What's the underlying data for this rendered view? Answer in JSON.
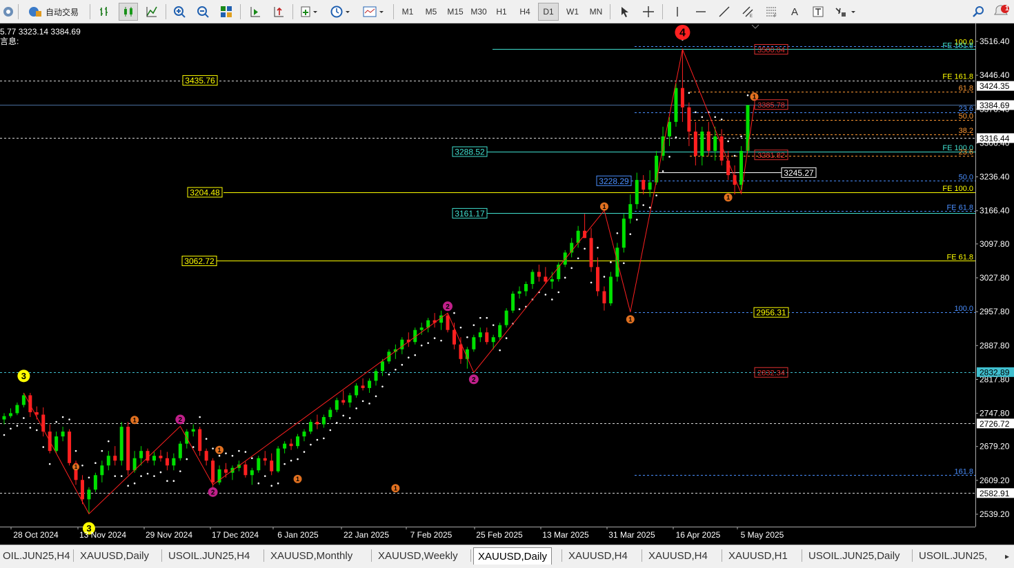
{
  "toolbar": {
    "auto_trade_label": "自动交易",
    "timeframes": [
      "M1",
      "M5",
      "M15",
      "M30",
      "H1",
      "H4",
      "D1",
      "W1",
      "MN"
    ],
    "active_timeframe": "D1",
    "text_tool": "A",
    "alert_count": "1"
  },
  "info": {
    "ohlc_fragment": "5.77 3323.14 3384.69",
    "line2": "言息:"
  },
  "price_axis": {
    "ticks": [
      "3516.40",
      "3446.40",
      "3376.40",
      "3306.40",
      "3236.40",
      "3166.40",
      "3097.80",
      "3027.80",
      "2957.80",
      "2887.80",
      "2817.80",
      "2747.80",
      "2679.20",
      "2609.20",
      "2539.20"
    ],
    "tags": [
      {
        "text": "3424.35",
        "style": "white"
      },
      {
        "text": "3384.69",
        "style": "white"
      },
      {
        "text": "3316.44",
        "style": "white"
      },
      {
        "text": "2832.89",
        "style": "cyan"
      },
      {
        "text": "2726.72",
        "style": "white"
      },
      {
        "text": "2582.91",
        "style": "white"
      }
    ]
  },
  "time_axis": [
    "28 Oct 2024",
    "13 Nov 2024",
    "29 Nov 2024",
    "17 Dec 2024",
    "6 Jan 2025",
    "22 Jan 2025",
    "7 Feb 2025",
    "25 Feb 2025",
    "13 Mar 2025",
    "31 Mar 2025",
    "16 Apr 2025",
    "5 May 2025"
  ],
  "price_labels": [
    {
      "text": "3435.76",
      "color": "#ffff00"
    },
    {
      "text": "3288.52",
      "color": "#40e0d0"
    },
    {
      "text": "3228.29",
      "color": "#4a8fff"
    },
    {
      "text": "3245.27",
      "color": "#ffffff"
    },
    {
      "text": "3204.48",
      "color": "#ffff00"
    },
    {
      "text": "3161.17",
      "color": "#40e0d0"
    },
    {
      "text": "3062.72",
      "color": "#ffff00"
    },
    {
      "text": "2956.31",
      "color": "#ffff00"
    },
    {
      "text": "3500.04",
      "color": "#e03030"
    },
    {
      "text": "3385.78",
      "color": "#e03030"
    },
    {
      "text": "3281.82",
      "color": "#e03030"
    },
    {
      "text": "2832.34",
      "color": "#e03030"
    }
  ],
  "fib_labels": [
    {
      "text": "100.0",
      "color": "#ffff00"
    },
    {
      "text": "FE 161.8",
      "color": "#40e0d0"
    },
    {
      "text": "FE 161.8",
      "color": "#ffff00"
    },
    {
      "text": "61.8",
      "color": "#ff9933"
    },
    {
      "text": "23.6",
      "color": "#4a8fff"
    },
    {
      "text": "50.0",
      "color": "#ff9933"
    },
    {
      "text": "38.2",
      "color": "#ff9933"
    },
    {
      "text": "FE 100.0",
      "color": "#40e0d0"
    },
    {
      "text": "23.6",
      "color": "#ff9933"
    },
    {
      "text": "50.0",
      "color": "#4a8fff"
    },
    {
      "text": "FE 100.0",
      "color": "#ffff00"
    },
    {
      "text": "FE 61.8",
      "color": "#4a8fff"
    },
    {
      "text": "FE 61.8",
      "color": "#ffff00"
    },
    {
      "text": "100.0",
      "color": "#4a8fff"
    },
    {
      "text": "161.8",
      "color": "#4a8fff"
    }
  ],
  "wave_labels": [
    {
      "text": "3",
      "color": "#ffff00"
    },
    {
      "text": "4",
      "color": "#ff2020"
    },
    {
      "text": "1",
      "color": "#e07020"
    },
    {
      "text": "2",
      "color": "#c0208a"
    }
  ],
  "tabs": [
    "OIL.JUN25,H4",
    "XAUUSD,Daily",
    "USOIL.JUN25,H4",
    "XAUUSD,Monthly",
    "XAUUSD,Weekly",
    "XAUUSD,Daily",
    "XAUUSD,H4",
    "XAUUSD,H4",
    "XAUUSD,H1",
    "USOIL.JUN25,Daily",
    "USOIL.JUN25,"
  ],
  "active_tab": 5,
  "chart_data": {
    "type": "candlestick",
    "symbol_timeframe": "XAUUSD,Daily",
    "ylim": [
      2510,
      3550
    ],
    "bull_color": "#00e000",
    "bear_color": "#ff2020",
    "candles": [
      [
        2735,
        2748,
        2725,
        2742
      ],
      [
        2742,
        2758,
        2738,
        2748
      ],
      [
        2748,
        2770,
        2744,
        2765
      ],
      [
        2765,
        2790,
        2760,
        2785
      ],
      [
        2785,
        2790,
        2740,
        2750
      ],
      [
        2750,
        2762,
        2735,
        2745
      ],
      [
        2745,
        2760,
        2700,
        2710
      ],
      [
        2710,
        2725,
        2665,
        2670
      ],
      [
        2670,
        2710,
        2665,
        2700
      ],
      [
        2700,
        2720,
        2690,
        2710
      ],
      [
        2710,
        2715,
        2640,
        2645
      ],
      [
        2645,
        2650,
        2600,
        2610
      ],
      [
        2610,
        2620,
        2560,
        2570
      ],
      [
        2570,
        2595,
        2540,
        2590
      ],
      [
        2590,
        2625,
        2585,
        2620
      ],
      [
        2620,
        2650,
        2605,
        2640
      ],
      [
        2640,
        2670,
        2630,
        2660
      ],
      [
        2660,
        2680,
        2640,
        2650
      ],
      [
        2650,
        2730,
        2640,
        2720
      ],
      [
        2720,
        2730,
        2620,
        2630
      ],
      [
        2630,
        2670,
        2625,
        2655
      ],
      [
        2655,
        2680,
        2640,
        2670
      ],
      [
        2670,
        2675,
        2645,
        2650
      ],
      [
        2650,
        2668,
        2640,
        2660
      ],
      [
        2660,
        2672,
        2648,
        2655
      ],
      [
        2655,
        2668,
        2630,
        2640
      ],
      [
        2640,
        2665,
        2630,
        2655
      ],
      [
        2655,
        2690,
        2650,
        2685
      ],
      [
        2685,
        2715,
        2675,
        2710
      ],
      [
        2710,
        2725,
        2700,
        2715
      ],
      [
        2715,
        2720,
        2660,
        2670
      ],
      [
        2670,
        2675,
        2640,
        2650
      ],
      [
        2650,
        2655,
        2595,
        2605
      ],
      [
        2605,
        2640,
        2600,
        2632
      ],
      [
        2632,
        2645,
        2615,
        2625
      ],
      [
        2625,
        2640,
        2610,
        2635
      ],
      [
        2635,
        2650,
        2628,
        2642
      ],
      [
        2642,
        2648,
        2615,
        2620
      ],
      [
        2620,
        2635,
        2600,
        2630
      ],
      [
        2630,
        2660,
        2625,
        2655
      ],
      [
        2655,
        2670,
        2640,
        2650
      ],
      [
        2650,
        2665,
        2620,
        2628
      ],
      [
        2628,
        2680,
        2625,
        2675
      ],
      [
        2675,
        2690,
        2665,
        2685
      ],
      [
        2685,
        2695,
        2672,
        2680
      ],
      [
        2680,
        2705,
        2675,
        2700
      ],
      [
        2700,
        2715,
        2690,
        2710
      ],
      [
        2710,
        2735,
        2705,
        2730
      ],
      [
        2730,
        2745,
        2715,
        2725
      ],
      [
        2725,
        2745,
        2718,
        2740
      ],
      [
        2740,
        2760,
        2735,
        2755
      ],
      [
        2755,
        2780,
        2750,
        2775
      ],
      [
        2775,
        2795,
        2765,
        2770
      ],
      [
        2770,
        2790,
        2760,
        2785
      ],
      [
        2785,
        2810,
        2780,
        2805
      ],
      [
        2805,
        2820,
        2795,
        2800
      ],
      [
        2800,
        2820,
        2790,
        2815
      ],
      [
        2815,
        2840,
        2805,
        2835
      ],
      [
        2835,
        2860,
        2825,
        2855
      ],
      [
        2855,
        2880,
        2850,
        2875
      ],
      [
        2875,
        2890,
        2860,
        2880
      ],
      [
        2880,
        2905,
        2870,
        2900
      ],
      [
        2900,
        2915,
        2885,
        2895
      ],
      [
        2895,
        2925,
        2890,
        2920
      ],
      [
        2920,
        2935,
        2910,
        2925
      ],
      [
        2925,
        2945,
        2915,
        2940
      ],
      [
        2940,
        2955,
        2925,
        2935
      ],
      [
        2935,
        2960,
        2920,
        2950
      ],
      [
        2950,
        2955,
        2915,
        2920
      ],
      [
        2920,
        2935,
        2880,
        2890
      ],
      [
        2890,
        2905,
        2850,
        2860
      ],
      [
        2860,
        2885,
        2840,
        2880
      ],
      [
        2880,
        2910,
        2875,
        2905
      ],
      [
        2905,
        2925,
        2895,
        2915
      ],
      [
        2915,
        2925,
        2890,
        2895
      ],
      [
        2895,
        2910,
        2880,
        2905
      ],
      [
        2905,
        2935,
        2900,
        2930
      ],
      [
        2930,
        2965,
        2925,
        2960
      ],
      [
        2960,
        3000,
        2955,
        2995
      ],
      [
        2995,
        3010,
        2985,
        3000
      ],
      [
        3000,
        3020,
        2990,
        3015
      ],
      [
        3015,
        3045,
        3005,
        3040
      ],
      [
        3040,
        3055,
        3020,
        3030
      ],
      [
        3030,
        3050,
        3015,
        3020
      ],
      [
        3020,
        3040,
        3005,
        3025
      ],
      [
        3025,
        3060,
        3020,
        3055
      ],
      [
        3055,
        3085,
        3050,
        3080
      ],
      [
        3080,
        3110,
        3070,
        3100
      ],
      [
        3100,
        3135,
        3090,
        3125
      ],
      [
        3125,
        3160,
        3110,
        3110
      ],
      [
        3110,
        3130,
        3040,
        3050
      ],
      [
        3050,
        3070,
        2990,
        3000
      ],
      [
        3000,
        3010,
        2960,
        2975
      ],
      [
        2975,
        3040,
        2970,
        3030
      ],
      [
        3030,
        3100,
        3020,
        3090
      ],
      [
        3090,
        3160,
        3080,
        3150
      ],
      [
        3150,
        3200,
        3140,
        3180
      ],
      [
        3180,
        3245,
        3170,
        3230
      ],
      [
        3230,
        3240,
        3200,
        3210
      ],
      [
        3210,
        3250,
        3195,
        3225
      ],
      [
        3225,
        3290,
        3220,
        3280
      ],
      [
        3280,
        3340,
        3270,
        3320
      ],
      [
        3320,
        3360,
        3300,
        3350
      ],
      [
        3350,
        3430,
        3340,
        3420
      ],
      [
        3420,
        3500,
        3350,
        3380
      ],
      [
        3380,
        3390,
        3300,
        3330
      ],
      [
        3330,
        3350,
        3260,
        3280
      ],
      [
        3280,
        3340,
        3260,
        3330
      ],
      [
        3330,
        3350,
        3280,
        3290
      ],
      [
        3290,
        3340,
        3270,
        3320
      ],
      [
        3320,
        3335,
        3260,
        3270
      ],
      [
        3270,
        3290,
        3230,
        3240
      ],
      [
        3240,
        3260,
        3200,
        3220
      ],
      [
        3220,
        3300,
        3210,
        3290
      ],
      [
        3290,
        3385,
        3285,
        3384.69
      ]
    ]
  }
}
